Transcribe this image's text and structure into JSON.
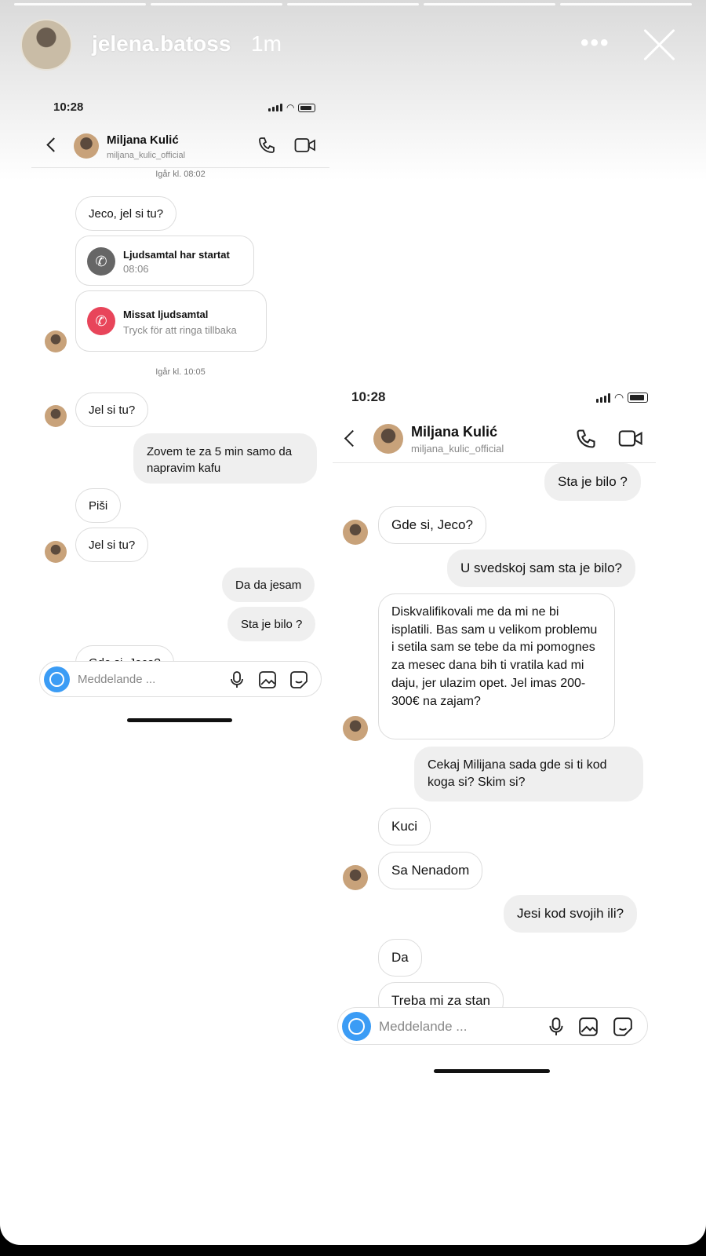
{
  "story": {
    "username": "jelena.batoss",
    "time": "1m",
    "more_icon": "more-dots-icon",
    "close_icon": "close-icon"
  },
  "shot_left": {
    "status_time": "10:28",
    "contact_name": "Miljana Kulić",
    "contact_username": "miljana_kulic_official",
    "stamp1": "Igår kl. 08:02",
    "stamp2": "Igår kl. 10:05",
    "messages": {
      "m1": "Jeco, jel si tu?",
      "call1_title": "Ljudsamtal har startat",
      "call1_sub": "08:06",
      "call2_title": "Missat ljudsamtal",
      "call2_sub": "Tryck för att ringa tillbaka",
      "m2": "Jel si tu?",
      "m3": "Zovem te za 5 min samo da napravim kafu",
      "m4": "Piši",
      "m5": "Jel si tu?",
      "m6": "Da da jesam",
      "m7": "Sta je bilo ?",
      "m8": "Gde si, Jeco?"
    },
    "composer_placeholder": "Meddelande ..."
  },
  "shot_right": {
    "status_time": "10:28",
    "contact_name": "Miljana Kulić",
    "contact_username": "miljana_kulic_official",
    "messages": {
      "r1": "Sta je bilo ?",
      "r2": "Gde si, Jeco?",
      "r3": "U svedskoj sam sta je bilo?",
      "r4": "Diskvalifikovali me da mi ne bi isplatili. Bas sam u velikom problemu i setila sam se tebe da mi pomognes za mesec dana bih ti vratila kad mi daju, jer ulazim opet. Jel imas 200-300€ na zajam?",
      "r5": "Cekaj Milijana sada gde si ti kod koga si? Skim si?",
      "r6": "Kuci",
      "r7": "Sa Nenadom",
      "r8": "Jesi kod svojih ili?",
      "r9": "Da",
      "r10": "Treba mi za stan"
    },
    "composer_placeholder": "Meddelande ..."
  },
  "colors": {
    "accent_blue": "#3b9cf5",
    "missed_red": "#e8455a",
    "outgoing_bubble": "#efefef"
  }
}
